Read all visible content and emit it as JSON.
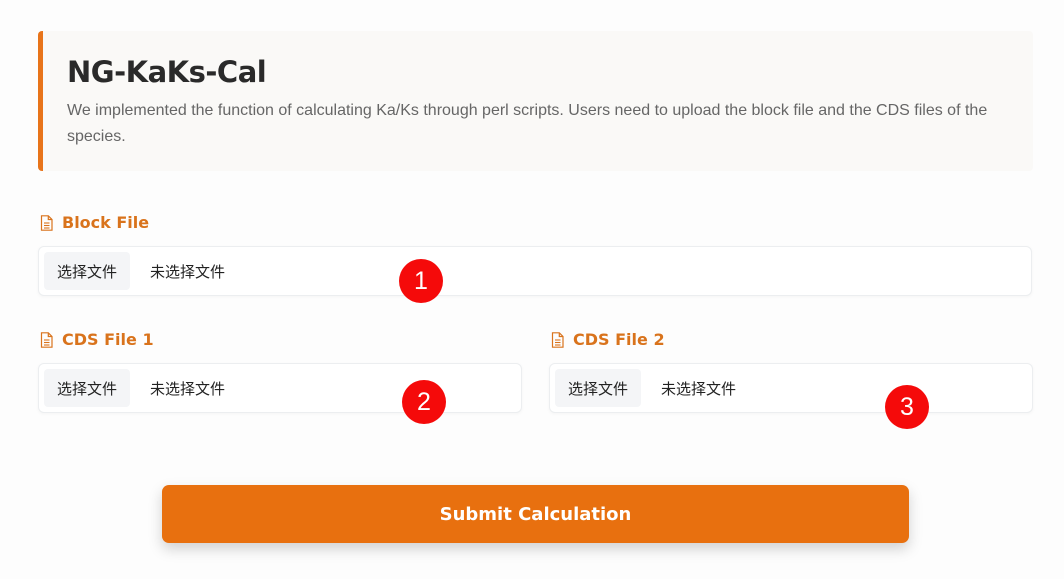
{
  "header": {
    "title": "NG-KaKs-Cal",
    "description": "We implemented the function of calculating Ka/Ks through perl scripts. Users need to upload the block file and the CDS files of the species."
  },
  "fields": {
    "block": {
      "label": "Block File",
      "button": "选择文件",
      "status": "未选择文件",
      "marker": "1"
    },
    "cds1": {
      "label": "CDS File 1",
      "button": "选择文件",
      "status": "未选择文件",
      "marker": "2"
    },
    "cds2": {
      "label": "CDS File 2",
      "button": "选择文件",
      "status": "未选择文件",
      "marker": "3"
    }
  },
  "submit": {
    "label": "Submit Calculation"
  },
  "colors": {
    "accent": "#e8741a",
    "label": "#d9731c",
    "marker": "#f50a0a",
    "submit": "#e8700f"
  },
  "icons": {
    "field_icon": "document-icon"
  }
}
